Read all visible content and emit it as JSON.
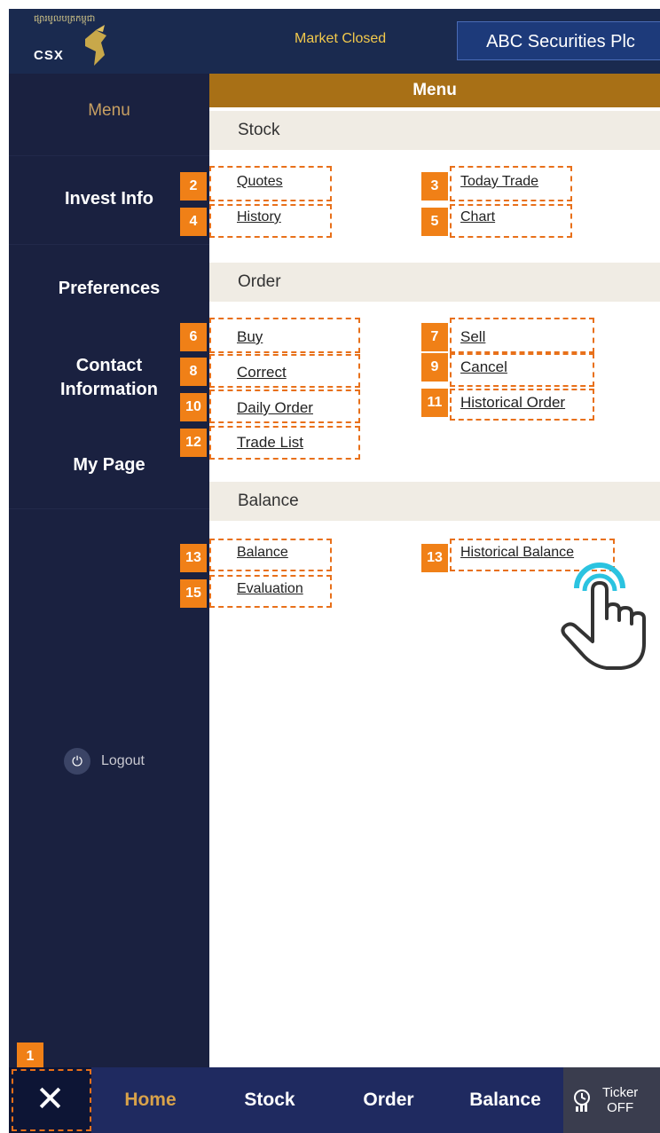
{
  "header": {
    "logo_text_khmer": "ផ្សារមូលបត្រកម្ពុជា",
    "logo_text": "CSX",
    "market_status": "Market Closed",
    "broker_name": "ABC Securities Plc"
  },
  "sidebar": {
    "title": "Menu",
    "items": [
      {
        "label": "Invest Info"
      },
      {
        "label": "Preferences"
      },
      {
        "label": "Contact Information"
      },
      {
        "label": "My Page"
      }
    ],
    "logout_label": "Logout"
  },
  "menu": {
    "title": "Menu",
    "stock": {
      "title": "Stock",
      "links": [
        "Quotes",
        "Today Trade",
        "History",
        "Chart"
      ]
    },
    "order": {
      "title": "Order",
      "links": [
        "Buy",
        "Sell",
        "Correct",
        "Cancel",
        "Daily Order",
        "Historical Order",
        "Trade List"
      ]
    },
    "balance": {
      "title": "Balance",
      "links": [
        "Balance",
        "Historical Balance",
        "Evaluation"
      ]
    }
  },
  "badges": [
    "1",
    "2",
    "3",
    "4",
    "5",
    "6",
    "7",
    "8",
    "9",
    "10",
    "11",
    "12",
    "13",
    "13",
    "15"
  ],
  "tabbar": {
    "close_icon": "close-icon",
    "tabs": [
      "Home",
      "Stock",
      "Order",
      "Balance"
    ],
    "ticker_line1": "Ticker",
    "ticker_line2": "OFF"
  },
  "colors": {
    "header_bg": "#1a2a4f",
    "sidebar_bg": "#1a2140",
    "menu_accent": "#a87016",
    "annotation": "#f08017",
    "market_status": "#f2c94c"
  }
}
